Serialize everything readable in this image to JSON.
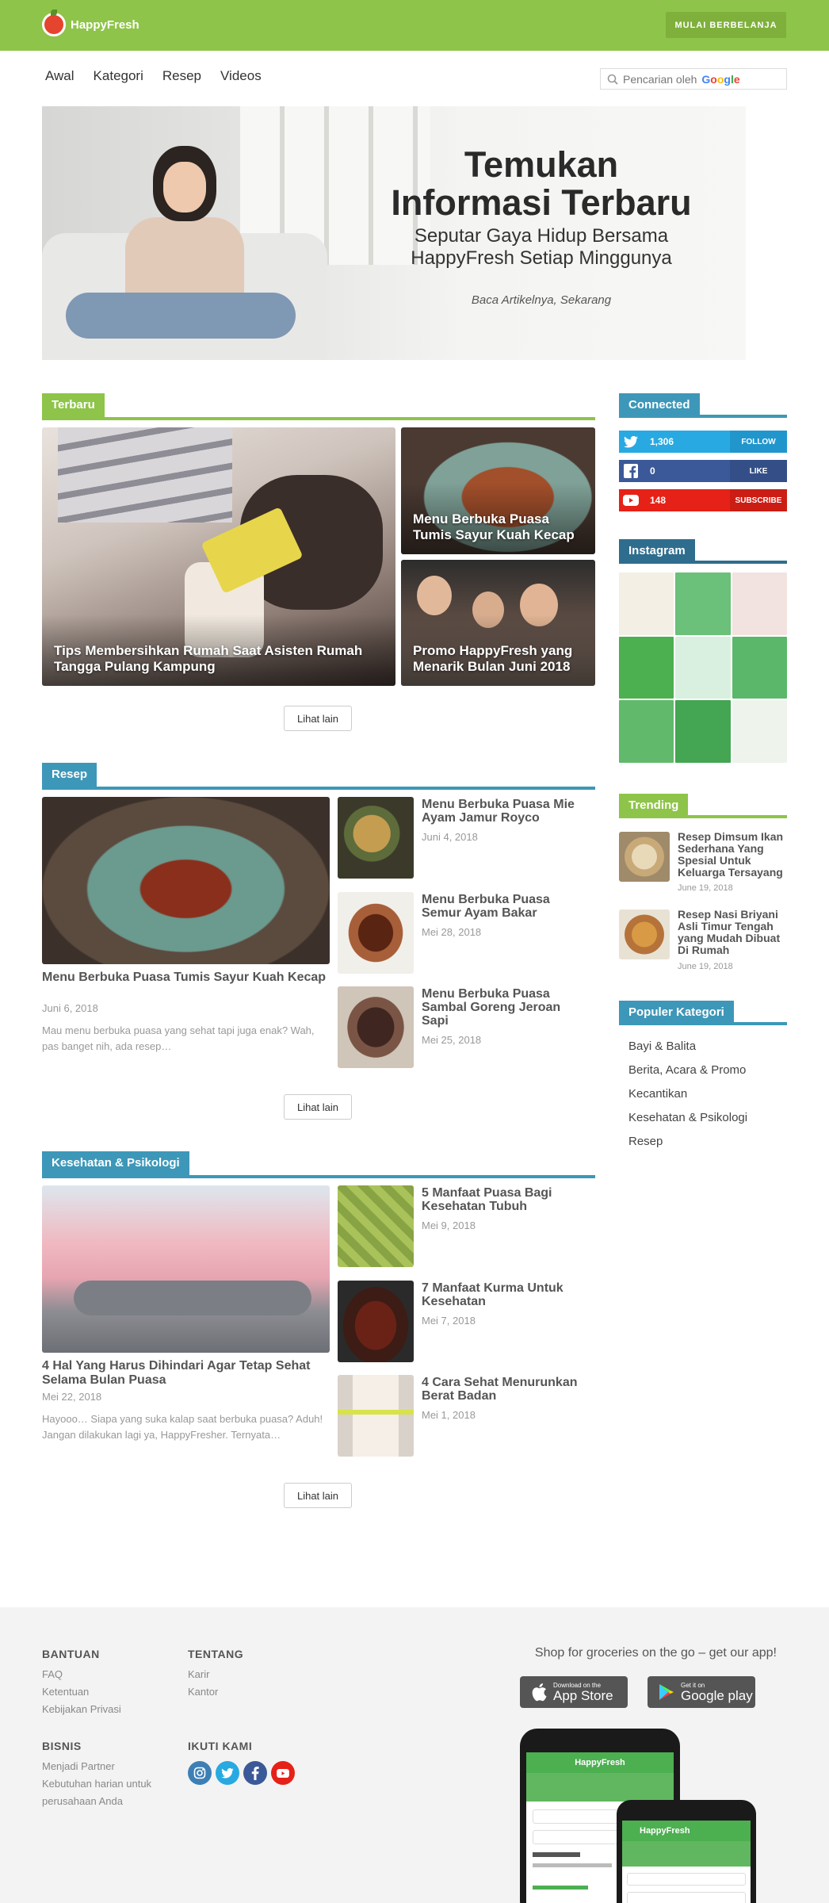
{
  "header": {
    "logo_text": "HappyFresh",
    "cta_label": "MULAI BERBELANJA",
    "accent_color": "#8ec449"
  },
  "nav": {
    "items": [
      "Awal",
      "Kategori",
      "Resep",
      "Videos"
    ],
    "search_placeholder": "Pencarian oleh",
    "search_brand": "Google"
  },
  "banner": {
    "title": "Temukan Informasi Terbaru",
    "subtitle": "Seputar Gaya Hidup Bersama HappyFresh Setiap Minggunya",
    "tagline": "Baca Artikelnya, Sekarang"
  },
  "terbaru": {
    "label": "Terbaru",
    "main_caption": "Tips Membersihkan Rumah Saat Asisten Rumah Tangga Pulang Kampung",
    "side1_caption": "Menu Berbuka Puasa Tumis Sayur Kuah Kecap",
    "side2_caption": "Promo HappyFresh yang Menarik Bulan Juni 2018",
    "more_label": "Lihat lain"
  },
  "resep": {
    "label": "Resep",
    "main_title": "Menu Berbuka Puasa Tumis Sayur Kuah Kecap",
    "main_date": "Juni 6, 2018",
    "main_excerpt": "Mau menu berbuka puasa yang sehat tapi juga enak? Wah, pas banget nih, ada resep…",
    "items": [
      {
        "title": "Menu Berbuka Puasa Mie Ayam Jamur Royco",
        "date": "Juni 4, 2018"
      },
      {
        "title": "Menu Berbuka Puasa Semur Ayam Bakar",
        "date": "Mei 28, 2018"
      },
      {
        "title": "Menu Berbuka Puasa Sambal Goreng Jeroan Sapi",
        "date": "Mei 25, 2018"
      }
    ],
    "more_label": "Lihat lain"
  },
  "kesehatan": {
    "label": "Kesehatan & Psikologi",
    "main_title": "4 Hal Yang Harus Dihindari Agar Tetap Sehat Selama Bulan Puasa",
    "main_date": "Mei 22, 2018",
    "main_excerpt": "Hayooo… Siapa yang suka kalap saat berbuka puasa? Aduh! Jangan dilakukan lagi ya, HappyFresher. Ternyata…",
    "items": [
      {
        "title": "5 Manfaat Puasa Bagi Kesehatan Tubuh",
        "date": "Mei 9, 2018"
      },
      {
        "title": "7 Manfaat Kurma Untuk Kesehatan",
        "date": "Mei 7, 2018"
      },
      {
        "title": "4 Cara Sehat Menurunkan Berat Badan",
        "date": "Mei 1, 2018"
      }
    ],
    "more_label": "Lihat lain"
  },
  "sidebar": {
    "connected_label": "Connected",
    "social": [
      {
        "network": "twitter",
        "count": "1,306",
        "action": "FOLLOW",
        "color": "#29a9e1"
      },
      {
        "network": "facebook",
        "count": "0",
        "action": "LIKE",
        "color": "#3b5998"
      },
      {
        "network": "youtube",
        "count": "148",
        "action": "SUBSCRIBE",
        "color": "#e62117"
      }
    ],
    "instagram_label": "Instagram",
    "trending_label": "Trending",
    "trending": [
      {
        "title": "Resep Dimsum Ikan Sederhana Yang Spesial Untuk Keluarga Tersayang",
        "date": "June 19, 2018"
      },
      {
        "title": "Resep Nasi Briyani Asli Timur Tengah yang Mudah Dibuat Di Rumah",
        "date": "June 19, 2018"
      }
    ],
    "populer_label": "Populer Kategori",
    "categories": [
      "Bayi & Balita",
      "Berita, Acara & Promo",
      "Kecantikan",
      "Kesehatan & Psikologi",
      "Resep"
    ]
  },
  "footer": {
    "bantuan": {
      "title": "BANTUAN",
      "links": [
        "FAQ",
        "Ketentuan",
        "Kebijakan Privasi"
      ]
    },
    "tentang": {
      "title": "TENTANG",
      "links": [
        "Karir",
        "Kantor"
      ]
    },
    "bisnis": {
      "title": "BISNIS",
      "links": [
        "Menjadi Partner",
        "Kebutuhan harian untuk perusahaan Anda"
      ]
    },
    "ikuti": {
      "title": "IKUTI KAMI"
    },
    "app_heading": "Shop for groceries on the go – get our app!",
    "appstore_small": "Download on the",
    "appstore_big": "App Store",
    "gplay_small": "Get it on",
    "gplay_big": "Google play",
    "phone_brand": "HappyFresh"
  }
}
